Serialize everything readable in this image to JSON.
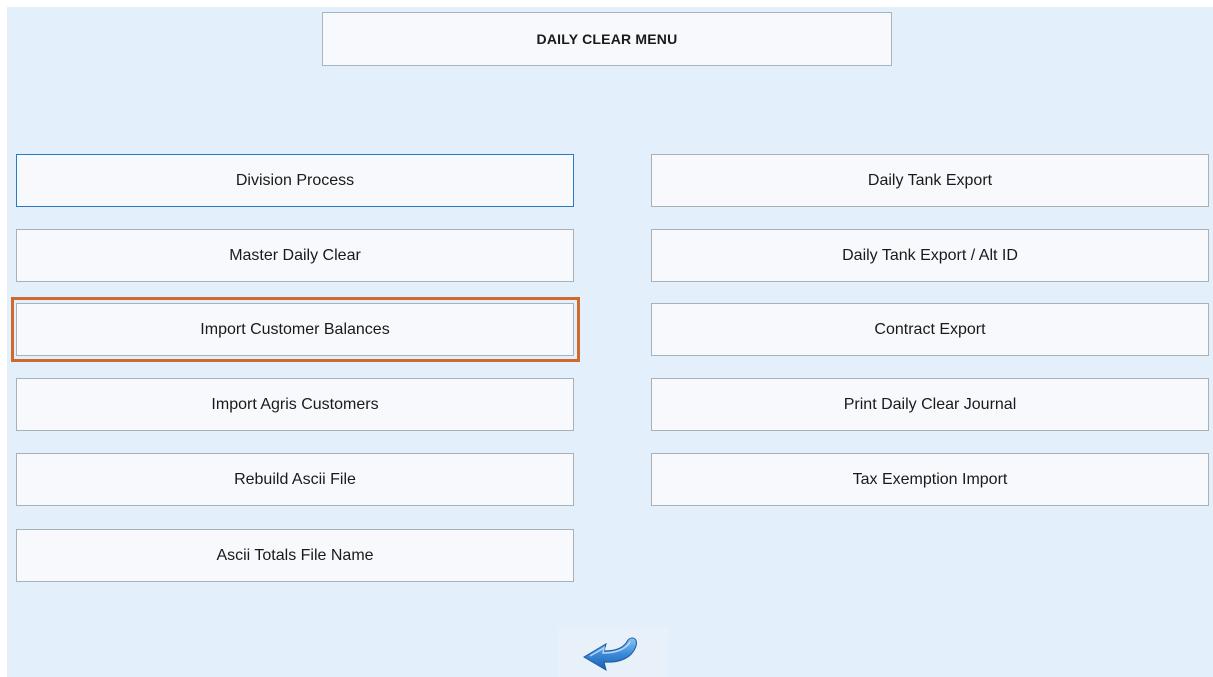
{
  "title": "DAILY CLEAR MENU",
  "left_buttons": [
    {
      "label": "Division Process"
    },
    {
      "label": "Master Daily Clear"
    },
    {
      "label": "Import Customer Balances"
    },
    {
      "label": "Import Agris Customers"
    },
    {
      "label": "Rebuild Ascii File"
    },
    {
      "label": "Ascii Totals File Name"
    }
  ],
  "right_buttons": [
    {
      "label": "Daily Tank Export"
    },
    {
      "label": "Daily Tank Export / Alt ID"
    },
    {
      "label": "Contract Export"
    },
    {
      "label": "Print Daily Clear Journal"
    },
    {
      "label": "Tax Exemption Import"
    }
  ],
  "icons": {
    "back": "back-arrow-icon"
  },
  "colors": {
    "background": "#e3effb",
    "button_face": "#f7f9fc",
    "focus_border": "#2b7bc4",
    "highlight_frame": "#d06a2c",
    "arrow_blue": "#2f7fd0"
  }
}
